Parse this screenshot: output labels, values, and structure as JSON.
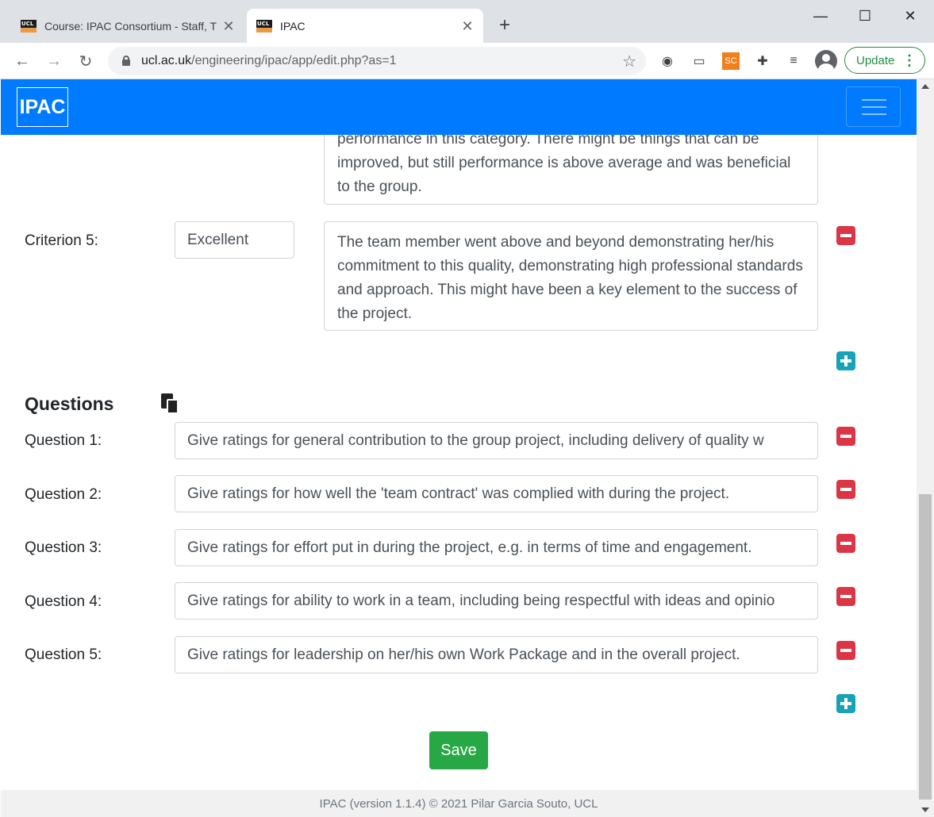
{
  "browser": {
    "tabs": [
      {
        "title": "Course: IPAC Consortium - Staff, T",
        "favicon_text": "UCL"
      },
      {
        "title": "IPAC",
        "favicon_text": "UCL"
      }
    ],
    "new_tab": "+",
    "url_domain": "ucl.ac.uk",
    "url_path": "/engineering/ipac/app/edit.php?as=1",
    "update_label": "Update",
    "extension_sc": "SC"
  },
  "navbar": {
    "brand": "IPAC",
    "color": "#007bff"
  },
  "criteria": {
    "prev_description": "performance in this category.  There might be things that can be improved, but still performance is above average and was beneficial to the group.",
    "criterion5": {
      "label": "Criterion 5:",
      "value": "Excellent",
      "description": "The team member went above and beyond demonstrating her/his commitment to this quality, demonstrating high professional standards and approach.  This might have been a key element to the success of the project."
    }
  },
  "questions": {
    "heading": "Questions",
    "items": [
      {
        "label": "Question 1:",
        "value": "Give ratings for general contribution to the group project, including delivery of quality w"
      },
      {
        "label": "Question 2:",
        "value": "Give ratings for how well the 'team contract' was complied with during the project."
      },
      {
        "label": "Question 3:",
        "value": "Give ratings for effort put in during the project, e.g. in terms of time and engagement."
      },
      {
        "label": "Question 4:",
        "value": "Give ratings for ability to work in a team, including being respectful with ideas and opinio"
      },
      {
        "label": "Question 5:",
        "value": "Give ratings for leadership on her/his own Work Package and in the overall project."
      }
    ]
  },
  "save_label": "Save",
  "footer": "IPAC (version 1.1.4) © 2021 Pilar Garcia Souto, UCL"
}
